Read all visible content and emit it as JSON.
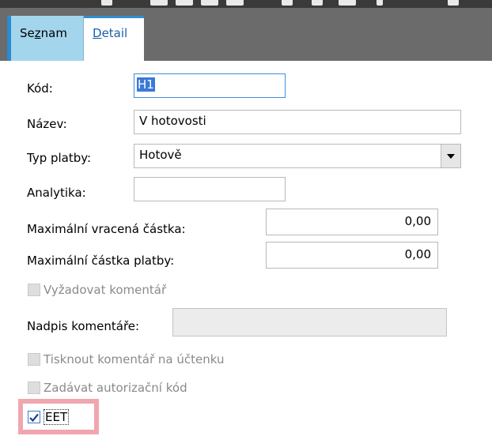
{
  "tabs": {
    "seznam": {
      "label_pre": "Se",
      "label_ul": "z",
      "label_post": "nam"
    },
    "detail": {
      "label_ul": "D",
      "label_post": "etail"
    }
  },
  "form": {
    "kod": {
      "label": "Kód:",
      "value": "H1"
    },
    "nazev": {
      "label": "Název:",
      "value": "V hotovosti"
    },
    "typ_platby": {
      "label": "Typ platby:",
      "value": "Hotově"
    },
    "analytika": {
      "label": "Analytika:",
      "value": ""
    },
    "max_vracena": {
      "label": "Maximální vracená částka:",
      "value": "0,00"
    },
    "max_platby": {
      "label": "Maximální částka platby:",
      "value": "0,00"
    },
    "vyzadovat_komentar": {
      "label": "Vyžadovat komentář",
      "checked": false
    },
    "nadpis_komentare": {
      "label": "Nadpis komentáře:",
      "value": ""
    },
    "tisknout_komentar": {
      "label": "Tisknout komentář na účtenku",
      "checked": false
    },
    "autorizacni_kod": {
      "label": "Zadávat autorizační kód",
      "checked": false
    },
    "eet": {
      "label": "EET",
      "checked": true
    }
  },
  "colors": {
    "accent": "#2a8bd0",
    "tab_inactive": "#a3d6ec",
    "highlight": "#f0a6ae"
  }
}
